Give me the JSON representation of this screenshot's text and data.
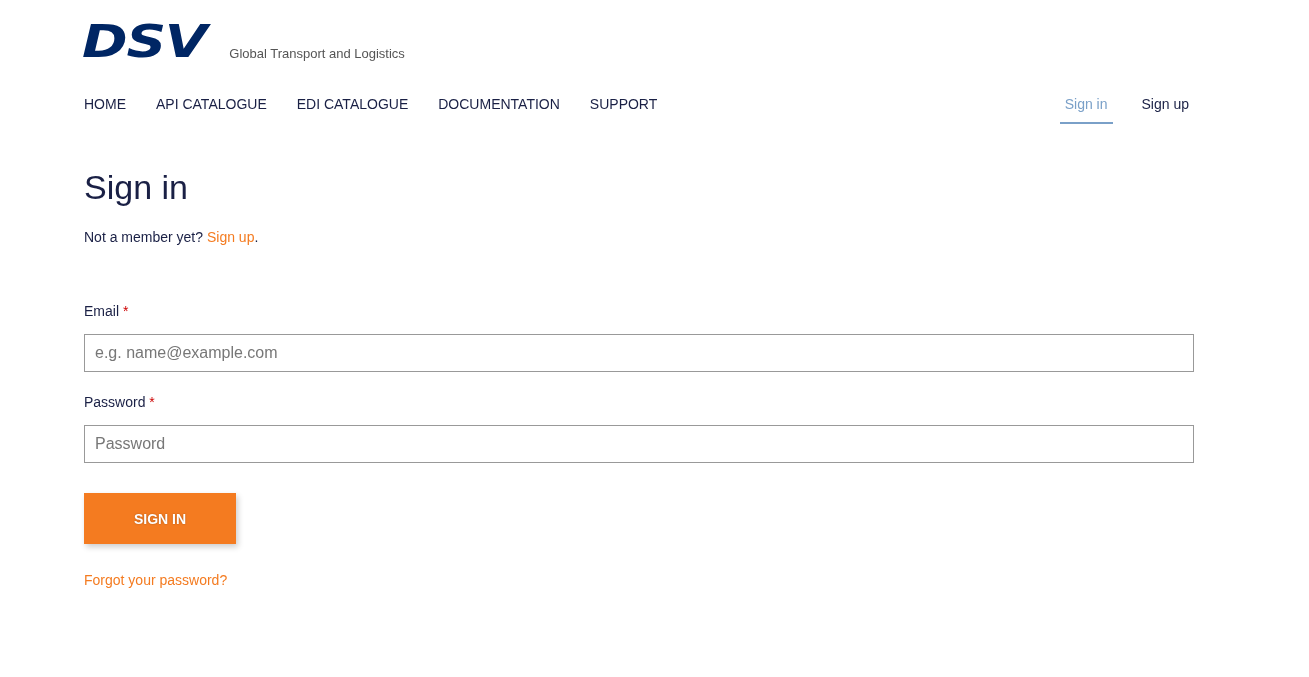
{
  "header": {
    "logo": "DSV",
    "tagline": "Global Transport and Logistics"
  },
  "nav": [
    {
      "label": "HOME",
      "selected": false
    },
    {
      "label": "API CATALOGUE",
      "selected": false
    },
    {
      "label": "EDI CATALOGUE",
      "selected": false
    },
    {
      "label": "DOCUMENTATION",
      "selected": false
    },
    {
      "label": "SUPPORT",
      "selected": false
    }
  ],
  "account_nav": [
    {
      "label": "Sign in",
      "selected": true
    },
    {
      "label": "Sign up",
      "selected": false
    }
  ],
  "title": "Sign in",
  "prompt": {
    "text": "Not a member yet?",
    "link": "Sign up",
    "end": "."
  },
  "fields": [
    {
      "label": "Email",
      "required": "*",
      "placeholder": "e.g. name@example.com"
    },
    {
      "label": "Password",
      "required": "*",
      "placeholder": "Password"
    }
  ],
  "submit": "SIGN IN",
  "forgot": "Forgot your password?"
}
